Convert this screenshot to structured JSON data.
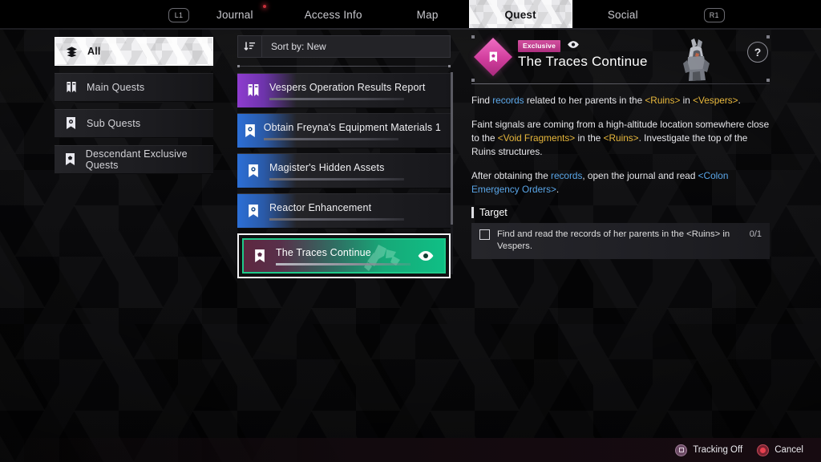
{
  "topbar": {
    "left_bumper": "L1",
    "right_bumper": "R1",
    "tabs": [
      {
        "label": "Journal",
        "active": false,
        "notify": true
      },
      {
        "label": "Access Info",
        "active": false,
        "notify": false
      },
      {
        "label": "Map",
        "active": false,
        "notify": false
      },
      {
        "label": "Quest",
        "active": true,
        "notify": false
      },
      {
        "label": "Social",
        "active": false,
        "notify": false
      }
    ]
  },
  "sidebar": {
    "items": [
      {
        "label": "All",
        "icon": "layers-icon",
        "active": true
      },
      {
        "label": "Main Quests",
        "icon": "main-quest-banner-icon",
        "active": false
      },
      {
        "label": "Sub Quests",
        "icon": "sub-quest-bookmark-icon",
        "active": false
      },
      {
        "label": "Descendant Exclusive Quests",
        "icon": "exclusive-quest-bookmark-icon",
        "active": false
      }
    ]
  },
  "quest_list": {
    "sort_label": "Sort by: New",
    "sort_icon": "sort-descending-icon",
    "items": [
      {
        "title": "Vespers Operation Results Report",
        "type": "main",
        "icon": "main-quest-banner-icon",
        "selected": false
      },
      {
        "title": "Obtain Freyna's Equipment Materials 1",
        "type": "sub",
        "icon": "sub-quest-bookmark-icon",
        "selected": false
      },
      {
        "title": "Magister's Hidden Assets",
        "type": "sub",
        "icon": "sub-quest-bookmark-icon",
        "selected": false
      },
      {
        "title": "Reactor Enhancement",
        "type": "sub",
        "icon": "sub-quest-bookmark-icon",
        "selected": false
      },
      {
        "title": "The Traces Continue",
        "type": "exclusive",
        "icon": "exclusive-quest-bookmark-icon",
        "selected": true,
        "tracking_icon": "eye-icon"
      }
    ]
  },
  "detail": {
    "badge": "Exclusive",
    "tracking_icon": "eye-icon",
    "title": "The Traces Continue",
    "help_label": "?",
    "portrait_alt": "descendant-portrait",
    "description": [
      [
        {
          "t": "Find ",
          "s": "plain"
        },
        {
          "t": "records",
          "s": "blue"
        },
        {
          "t": " related to her parents in the ",
          "s": "plain"
        },
        {
          "t": "<Ruins>",
          "s": "gold"
        },
        {
          "t": " in ",
          "s": "plain"
        },
        {
          "t": "<Vespers>",
          "s": "gold"
        },
        {
          "t": ".",
          "s": "plain"
        }
      ],
      [
        {
          "t": "Faint signals are coming from a high-altitude location somewhere close to the ",
          "s": "plain"
        },
        {
          "t": "<Void Fragments>",
          "s": "gold"
        },
        {
          "t": " in the ",
          "s": "plain"
        },
        {
          "t": "<Ruins>",
          "s": "gold"
        },
        {
          "t": ". Investigate the top of the Ruins structures.",
          "s": "plain"
        }
      ],
      [
        {
          "t": "After obtaining the ",
          "s": "plain"
        },
        {
          "t": "records",
          "s": "blue"
        },
        {
          "t": ", open the journal and read ",
          "s": "plain"
        },
        {
          "t": "<Colon Emergency Orders>",
          "s": "blue"
        },
        {
          "t": ".",
          "s": "plain"
        }
      ]
    ],
    "target_header": "Target",
    "targets": [
      {
        "text": "Find and read the records of her parents in the <Ruins> in Vespers.",
        "count": "0/1",
        "checked": false
      }
    ]
  },
  "bottombar": {
    "hints": [
      {
        "label": "Tracking Off",
        "button": "square-button-icon"
      },
      {
        "label": "Cancel",
        "button": "circle-button-icon"
      }
    ]
  },
  "colors": {
    "accent_green": "#0fbf85",
    "accent_pink": "#d13d9d",
    "main_quest_purple": "#8e3ccf",
    "sub_quest_blue": "#2c6fd6",
    "link_blue": "#5aa6e8",
    "link_gold": "#e8b83c"
  }
}
